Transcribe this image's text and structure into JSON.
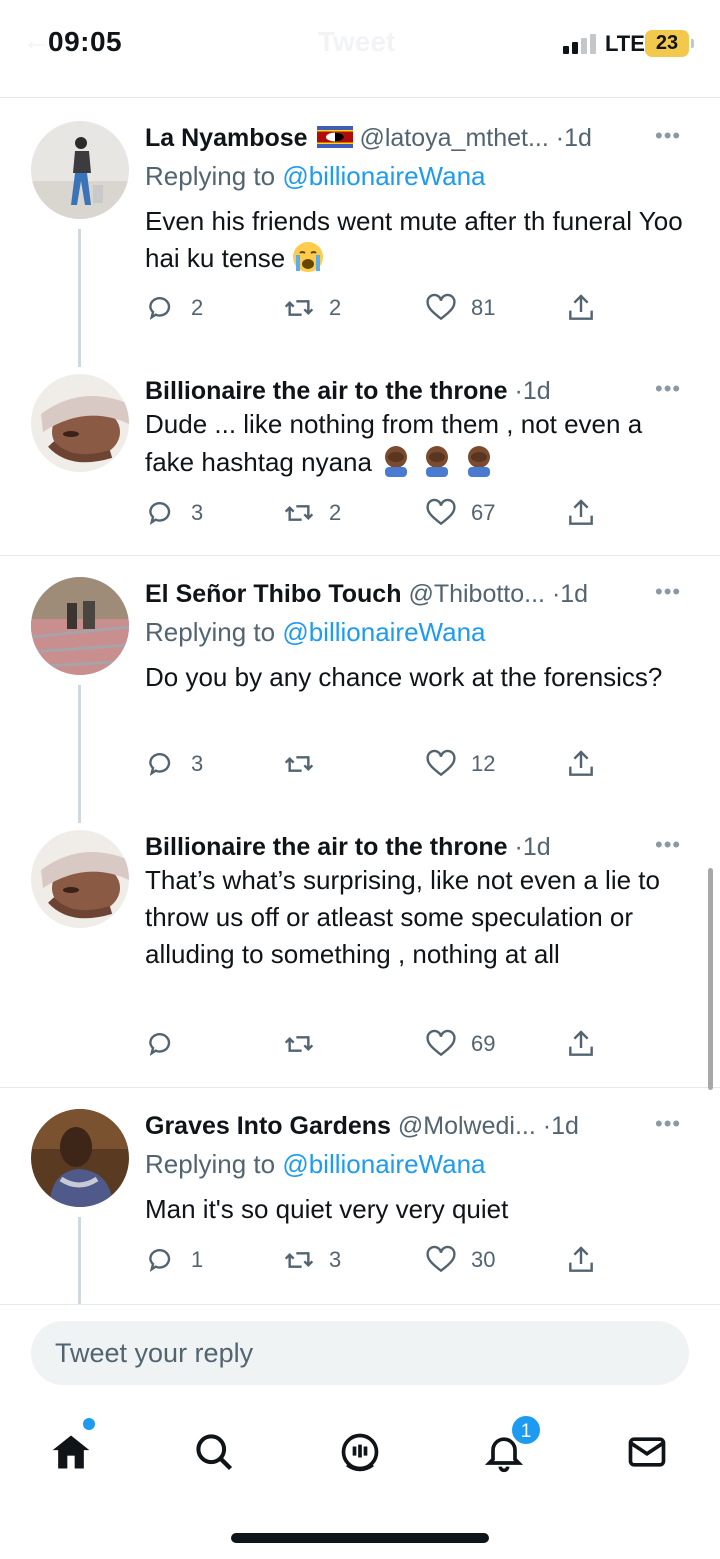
{
  "status_bar": {
    "time": "09:05",
    "network": "LTE",
    "battery": "23",
    "ghost_title": "Tweet"
  },
  "tweets": [
    {
      "name": "La Nyambose",
      "has_flag": true,
      "handle": "@latoya_mthet...",
      "age": "1d",
      "replying_prefix": "Replying to ",
      "replying_to": "@billionaireWana",
      "text": "Even his friends went mute after th funeral Yoo hai ku tense",
      "emoji": "loudly-crying-face",
      "replies": "2",
      "retweets": "2",
      "likes": "81"
    },
    {
      "name": "Billionaire the air to the throne",
      "handle": "",
      "age": "1d",
      "text": "Dude ... like nothing from them , not even a fake hashtag nyana",
      "emoji": "face-palm-x3",
      "replies": "3",
      "retweets": "2",
      "likes": "67"
    },
    {
      "name": "El Señor Thibo Touch",
      "handle": "@Thibotto...",
      "age": "1d",
      "replying_prefix": "Replying to ",
      "replying_to": "@billionaireWana",
      "text": "Do you by any chance work at the forensics?",
      "replies": "3",
      "retweets": "",
      "likes": "12"
    },
    {
      "name": "Billionaire the air to the throne",
      "handle": "",
      "age": "1d",
      "text": "That’s what’s surprising, like not even a lie to throw us off or atleast some speculation or alluding to something , nothing at all",
      "replies": "",
      "retweets": "",
      "likes": "69"
    },
    {
      "name": "Graves Into Gardens",
      "handle": "@Molwedi...",
      "age": "1d",
      "replying_prefix": "Replying to ",
      "replying_to": "@billionaireWana",
      "text": "Man it's so quiet very very quiet",
      "replies": "1",
      "retweets": "3",
      "likes": "30"
    }
  ],
  "reply_bar": {
    "placeholder": "Tweet your reply"
  },
  "tab_bar": {
    "items": [
      "home-icon",
      "search-icon",
      "spaces-icon",
      "notifications-icon",
      "messages-icon"
    ],
    "notification_badge": "1"
  },
  "colors": {
    "accent": "#1d9bf0",
    "text": "#0f1419",
    "secondary": "#536471",
    "divider": "#e6e9eb"
  }
}
